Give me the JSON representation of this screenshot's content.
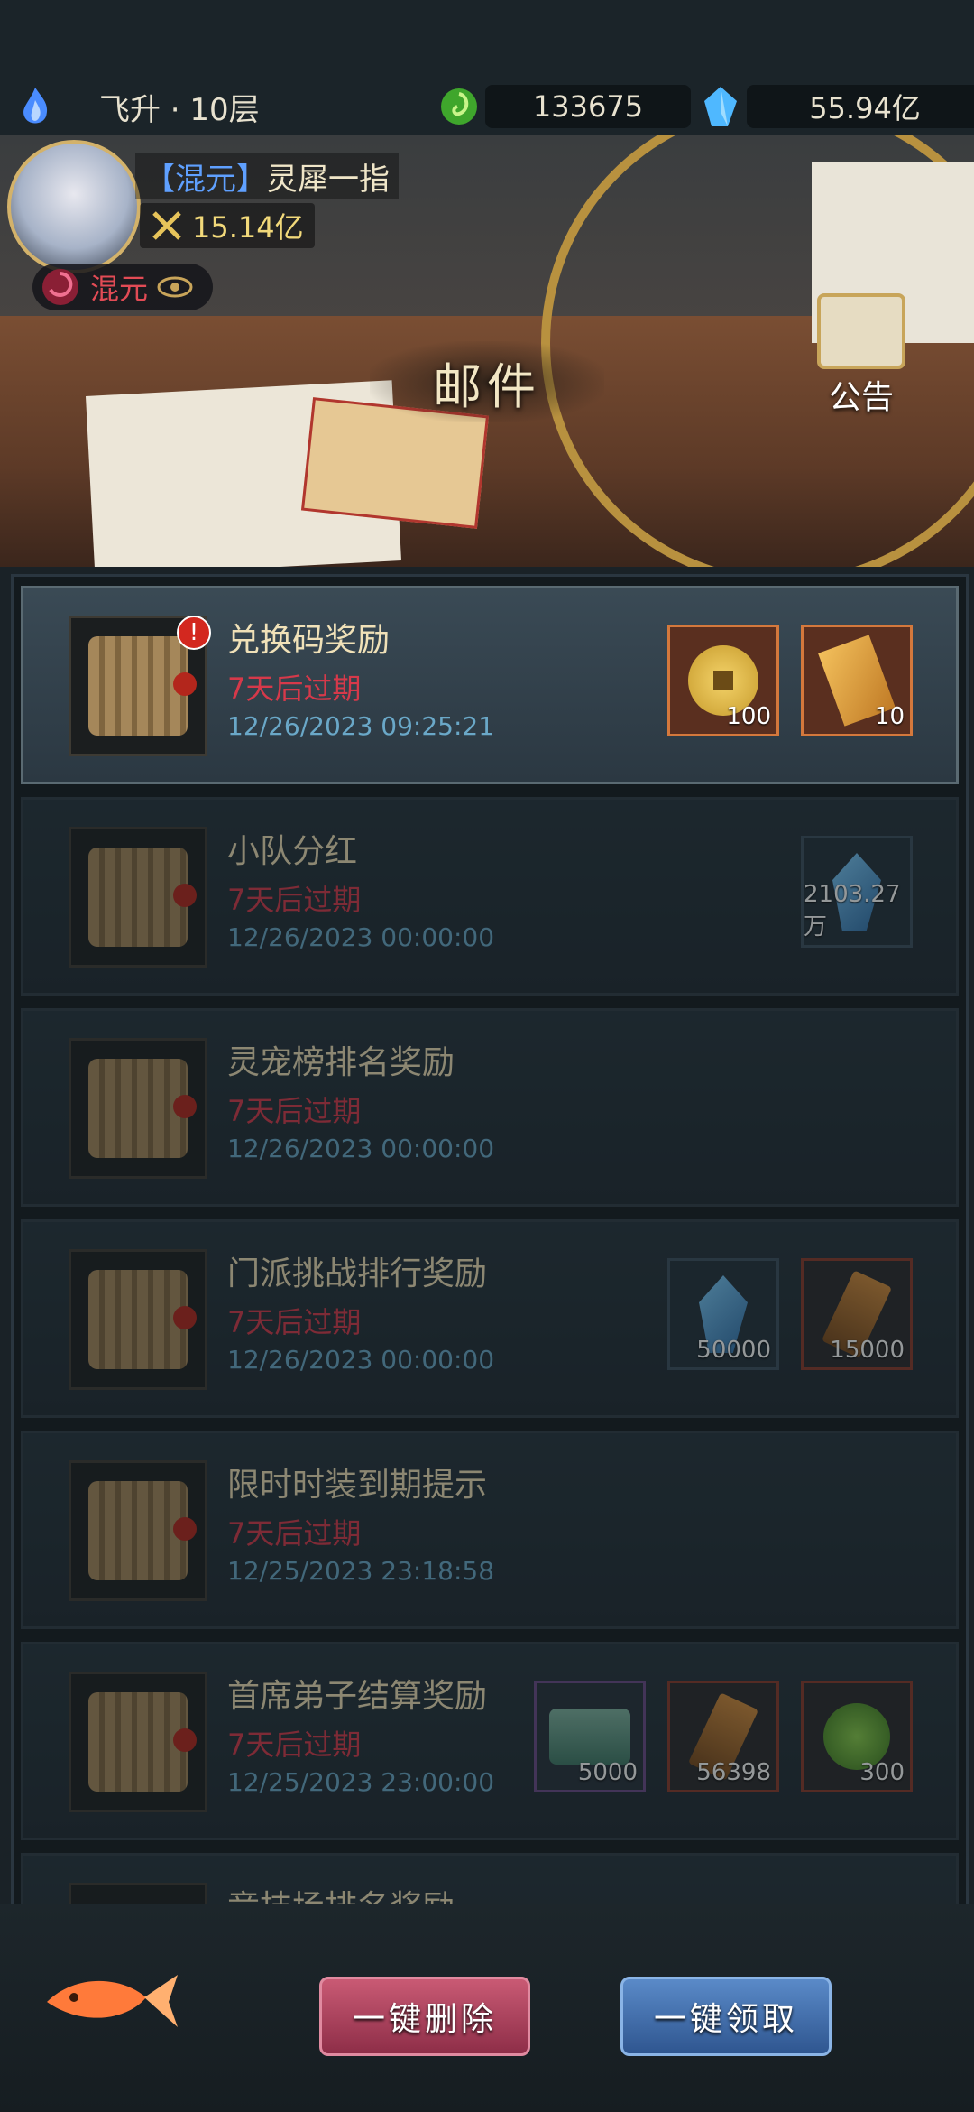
{
  "status": {
    "level_text": "飞升 · 10层",
    "jade_count": "133675",
    "crystal_count": "55.94亿"
  },
  "player": {
    "tag": "【混元】",
    "name": "灵犀一指",
    "power": "15.14亿",
    "rank": "混元"
  },
  "page": {
    "title": "邮件",
    "notice_label": "公告"
  },
  "mails": [
    {
      "title": "兑换码奖励",
      "expire": "7天后过期",
      "date": "12/26/2023 09:25:21",
      "rewards": [
        {
          "icon": "gold-coin",
          "count": "100"
        },
        {
          "icon": "talisman",
          "count": "10"
        }
      ]
    },
    {
      "title": "小队分红",
      "expire": "7天后过期",
      "date": "12/26/2023 00:00:00",
      "rewards": [
        {
          "icon": "blue-crystal",
          "count": "2103.27万"
        }
      ]
    },
    {
      "title": "灵宠榜排名奖励",
      "expire": "7天后过期",
      "date": "12/26/2023 00:00:00",
      "rewards": []
    },
    {
      "title": "门派挑战排行奖励",
      "expire": "7天后过期",
      "date": "12/26/2023 00:00:00",
      "rewards": [
        {
          "icon": "blue-crystal",
          "count": "50000"
        },
        {
          "icon": "token",
          "count": "15000"
        }
      ]
    },
    {
      "title": "限时时装到期提示",
      "expire": "7天后过期",
      "date": "12/25/2023 23:18:58",
      "rewards": []
    },
    {
      "title": "首席弟子结算奖励",
      "expire": "7天后过期",
      "date": "12/25/2023 23:00:00",
      "rewards": [
        {
          "icon": "green-scroll",
          "count": "5000"
        },
        {
          "icon": "token",
          "count": "56398"
        },
        {
          "icon": "jade",
          "count": "300"
        }
      ]
    },
    {
      "title": "竞技场排名奖励",
      "expire": "",
      "date": "",
      "rewards": []
    }
  ],
  "actions": {
    "delete_all": "一键删除",
    "claim_all": "一键领取"
  }
}
